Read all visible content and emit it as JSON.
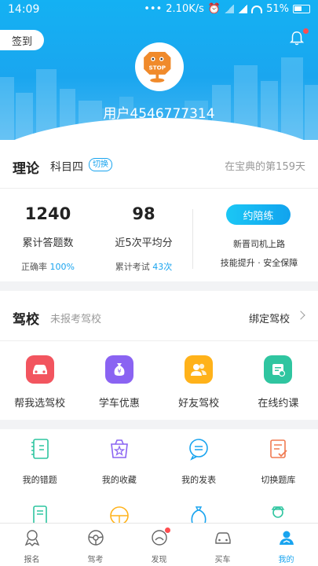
{
  "status_bar": {
    "time": "14:09",
    "network_speed": "2.10K/s",
    "battery": "51%"
  },
  "header": {
    "signin_label": "签到",
    "username": "用户4546777314",
    "avatar_text": "STOP"
  },
  "theory": {
    "title": "理论",
    "subject": "科目四",
    "switch_label": "切换",
    "days_text": "在宝典的第159天",
    "stats": [
      {
        "value": "1240",
        "label": "累计答题数",
        "sub_prefix": "正确率 ",
        "sub_value": "100%"
      },
      {
        "value": "98",
        "label": "近5次平均分",
        "sub_prefix": "累计考试 ",
        "sub_value": "43次"
      }
    ],
    "practice_button": "约陪练",
    "practice_line1": "新晋司机上路",
    "practice_line2": "技能提升 · 安全保障"
  },
  "school": {
    "title": "驾校",
    "subtitle": "未报考驾校",
    "bind_label": "绑定驾校",
    "items": [
      {
        "label": "帮我选驾校",
        "icon": "car-icon",
        "color": "#f2555f"
      },
      {
        "label": "学车优惠",
        "icon": "money-bag-icon",
        "color": "#8a63f2"
      },
      {
        "label": "好友驾校",
        "icon": "friends-icon",
        "color": "#ffb21a"
      },
      {
        "label": "在线约课",
        "icon": "calendar-icon",
        "color": "#2fc5a0"
      }
    ]
  },
  "tools": {
    "items": [
      {
        "label": "我的错题",
        "icon": "wrong-book-icon",
        "color": "#2fc5a0"
      },
      {
        "label": "我的收藏",
        "icon": "star-box-icon",
        "color": "#8a63f2"
      },
      {
        "label": "我的发表",
        "icon": "chat-icon",
        "color": "#19a4ef"
      },
      {
        "label": "切换题库",
        "icon": "list-check-icon",
        "color": "#f07b52"
      }
    ]
  },
  "tabbar": {
    "items": [
      {
        "label": "报名",
        "icon": "signup-icon"
      },
      {
        "label": "驾考",
        "icon": "steering-wheel-icon"
      },
      {
        "label": "发现",
        "icon": "discover-icon"
      },
      {
        "label": "买车",
        "icon": "buy-car-icon"
      },
      {
        "label": "我的",
        "icon": "me-icon"
      }
    ],
    "active_color": "#19a4ef"
  }
}
